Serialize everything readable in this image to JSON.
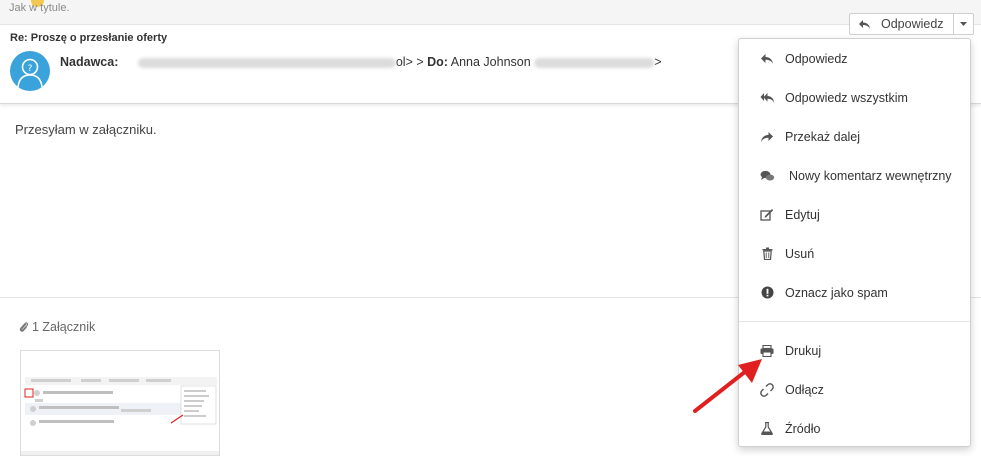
{
  "top_note": "Jak w tytule.",
  "message": {
    "subject": "Re: Proszę o przesłanie oferty",
    "sender_label": "Nadawca:",
    "sender_tail": "ol> >",
    "to_label": "Do:",
    "to_name": "Anna Johnson",
    "to_tail": ">",
    "body": "Przesyłam w załączniku."
  },
  "reply_button": {
    "label": "Odpowiedz"
  },
  "attachments": {
    "label": "1 Załącznik"
  },
  "menu": {
    "items": [
      {
        "label": "Odpowiedz",
        "icon": "reply-icon"
      },
      {
        "label": "Odpowiedz wszystkim",
        "icon": "reply-all-icon"
      },
      {
        "label": "Przekaż dalej",
        "icon": "forward-icon"
      },
      {
        "label": "Nowy komentarz wewnętrzny",
        "icon": "comments-icon"
      },
      {
        "label": "Edytuj",
        "icon": "edit-icon"
      },
      {
        "label": "Usuń",
        "icon": "trash-icon"
      },
      {
        "label": "Oznacz jako spam",
        "icon": "spam-icon"
      },
      {
        "label": "Drukuj",
        "icon": "print-icon"
      },
      {
        "label": "Odłącz",
        "icon": "unlink-icon"
      },
      {
        "label": "Źródło",
        "icon": "source-icon"
      }
    ]
  },
  "colors": {
    "avatar": "#3aa3dc",
    "arrow": "#e02020",
    "accent_dot": "#f2c94c"
  }
}
